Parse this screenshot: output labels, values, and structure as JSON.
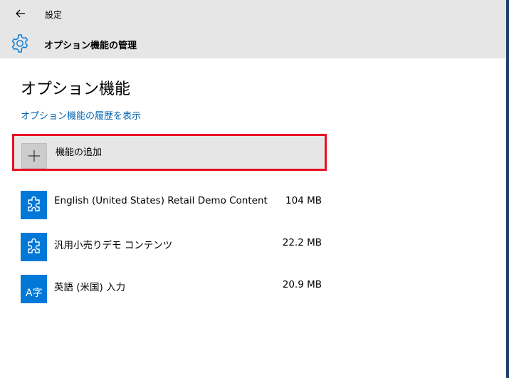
{
  "topbar": {
    "title": "設定"
  },
  "header": {
    "title": "オプション機能の管理"
  },
  "main": {
    "page_title": "オプション機能",
    "history_link": "オプション機能の履歴を表示",
    "add_feature_label": "機能の追加",
    "features": [
      {
        "name": "English (United States) Retail Demo Content",
        "size": "104 MB",
        "icon": "puzzle-icon"
      },
      {
        "name": "汎用小売りデモ コンテンツ",
        "size": "22.2 MB",
        "icon": "puzzle-icon"
      },
      {
        "name": "英語 (米国) 入力",
        "size": "20.9 MB",
        "icon": "language-icon",
        "icon_text": "A字"
      }
    ]
  },
  "colors": {
    "accent": "#0078d7",
    "link": "#0063b1",
    "highlight": "#e81123"
  }
}
